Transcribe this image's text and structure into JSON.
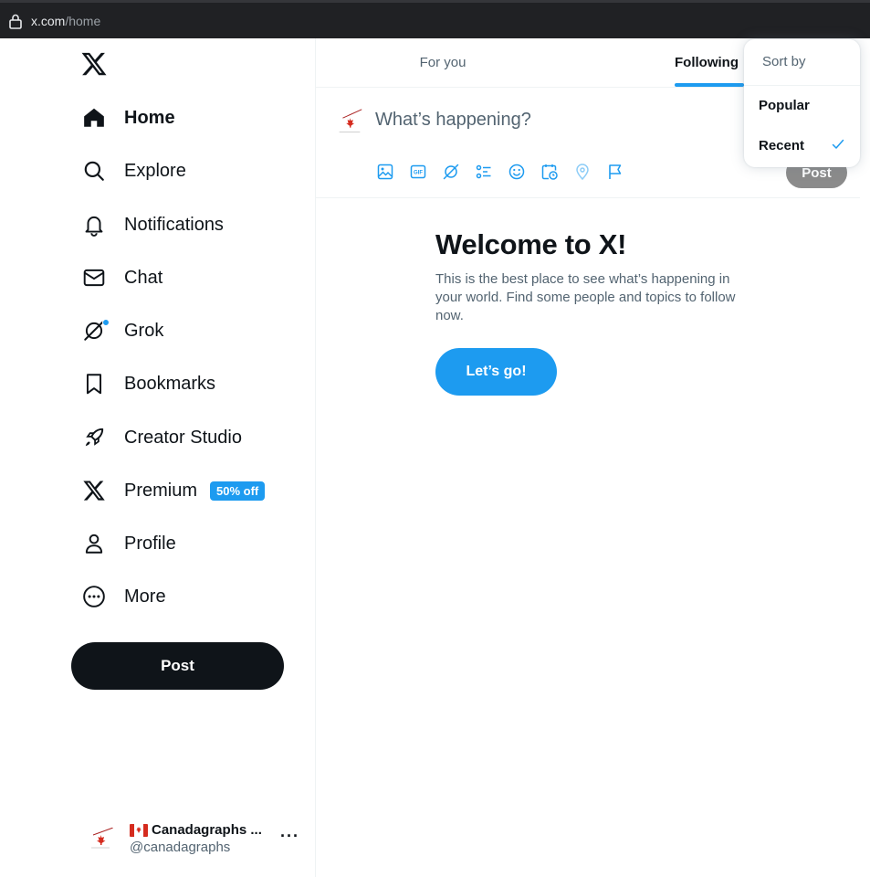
{
  "browser": {
    "url_host": "x.com",
    "url_path": "/home"
  },
  "sidebar": {
    "items": [
      {
        "label": "Home",
        "icon": "home-icon",
        "active": true
      },
      {
        "label": "Explore",
        "icon": "search-icon"
      },
      {
        "label": "Notifications",
        "icon": "bell-icon"
      },
      {
        "label": "Chat",
        "icon": "envelope-icon"
      },
      {
        "label": "Grok",
        "icon": "grok-icon"
      },
      {
        "label": "Bookmarks",
        "icon": "bookmark-icon"
      },
      {
        "label": "Creator Studio",
        "icon": "rocket-icon"
      },
      {
        "label": "Premium",
        "icon": "x-logo-icon",
        "badge": "50% off"
      },
      {
        "label": "Profile",
        "icon": "person-icon"
      },
      {
        "label": "More",
        "icon": "more-circle-icon"
      }
    ],
    "post_button": "Post",
    "account": {
      "display_name": "Canadagraphs ...",
      "handle": "@canadagraphs"
    }
  },
  "main": {
    "tabs": [
      {
        "label": "For you"
      },
      {
        "label": "Following",
        "active": true
      }
    ],
    "composer": {
      "placeholder": "What’s happening?",
      "post_button": "Post"
    },
    "welcome": {
      "title": "Welcome to X!",
      "body": "This is the best place to see what’s happening in your world. Find some people and topics to follow now.",
      "button": "Let’s go!"
    }
  },
  "sort_menu": {
    "header": "Sort by",
    "options": [
      {
        "label": "Popular",
        "selected": false
      },
      {
        "label": "Recent",
        "selected": true
      }
    ]
  },
  "colors": {
    "accent": "#1d9bf0",
    "text": "#0f1419",
    "secondary": "#536471",
    "post_button_dark": "#0f1419"
  }
}
